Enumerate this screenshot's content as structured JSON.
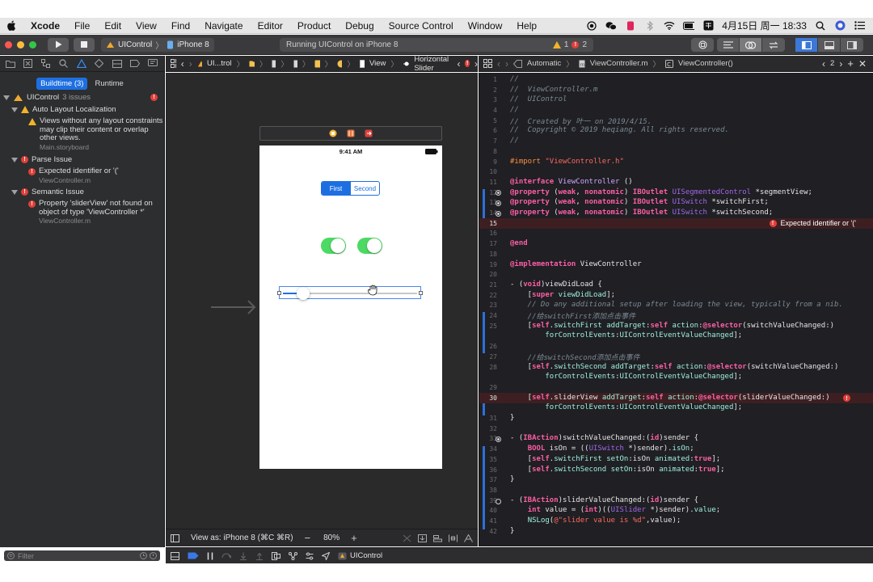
{
  "menubar": {
    "app_name": "Xcode",
    "items": [
      "File",
      "Edit",
      "View",
      "Find",
      "Navigate",
      "Editor",
      "Product",
      "Debug",
      "Source Control",
      "Window",
      "Help"
    ],
    "clock": "4月15日 周一 18:33"
  },
  "toolbar": {
    "scheme": "UIControl",
    "device": "iPhone 8",
    "status": "Running UIControl on iPhone 8",
    "warning_count": "1",
    "error_count": "2"
  },
  "navigator": {
    "tabs": [
      "Buildtime (3)",
      "Runtime"
    ],
    "project": "UIControl",
    "project_issue_count": "3 issues",
    "groups": [
      {
        "title": "Auto Layout Localization",
        "issue_lines": [
          "Views without any layout constraints",
          "may clip their content or overlap",
          "other views."
        ],
        "file": "Main.storyboard"
      },
      {
        "title": "Parse Issue",
        "issue_lines": [
          "Expected identifier or '('"
        ],
        "file": "ViewController.m"
      },
      {
        "title": "Semantic Issue",
        "issue_lines": [
          "Property 'sliderView' not found on",
          "object of type 'ViewController *'"
        ],
        "file": "ViewController.m"
      }
    ],
    "filter_placeholder": "Filter"
  },
  "canvas": {
    "breadcrumb": [
      "UI...trol",
      "View",
      "Horizontal Slider"
    ],
    "phone_time": "9:41 AM",
    "segment_labels": [
      "First",
      "Second"
    ],
    "view_as": "View as: iPhone 8 (⌘C ⌘R)",
    "zoom": "80%",
    "slider_value": 0.1
  },
  "editor": {
    "breadcrumb": [
      "Automatic",
      "ViewController.m",
      "ViewController()"
    ],
    "counterpart_count": "2",
    "inline_error": "Expected identifier or '('"
  },
  "debugbar": {
    "target": "UIControl"
  },
  "colors": {
    "accent": "#1d6fe1",
    "error": "#e0403a",
    "warning": "#f0b429",
    "switch_on": "#4cd964"
  }
}
